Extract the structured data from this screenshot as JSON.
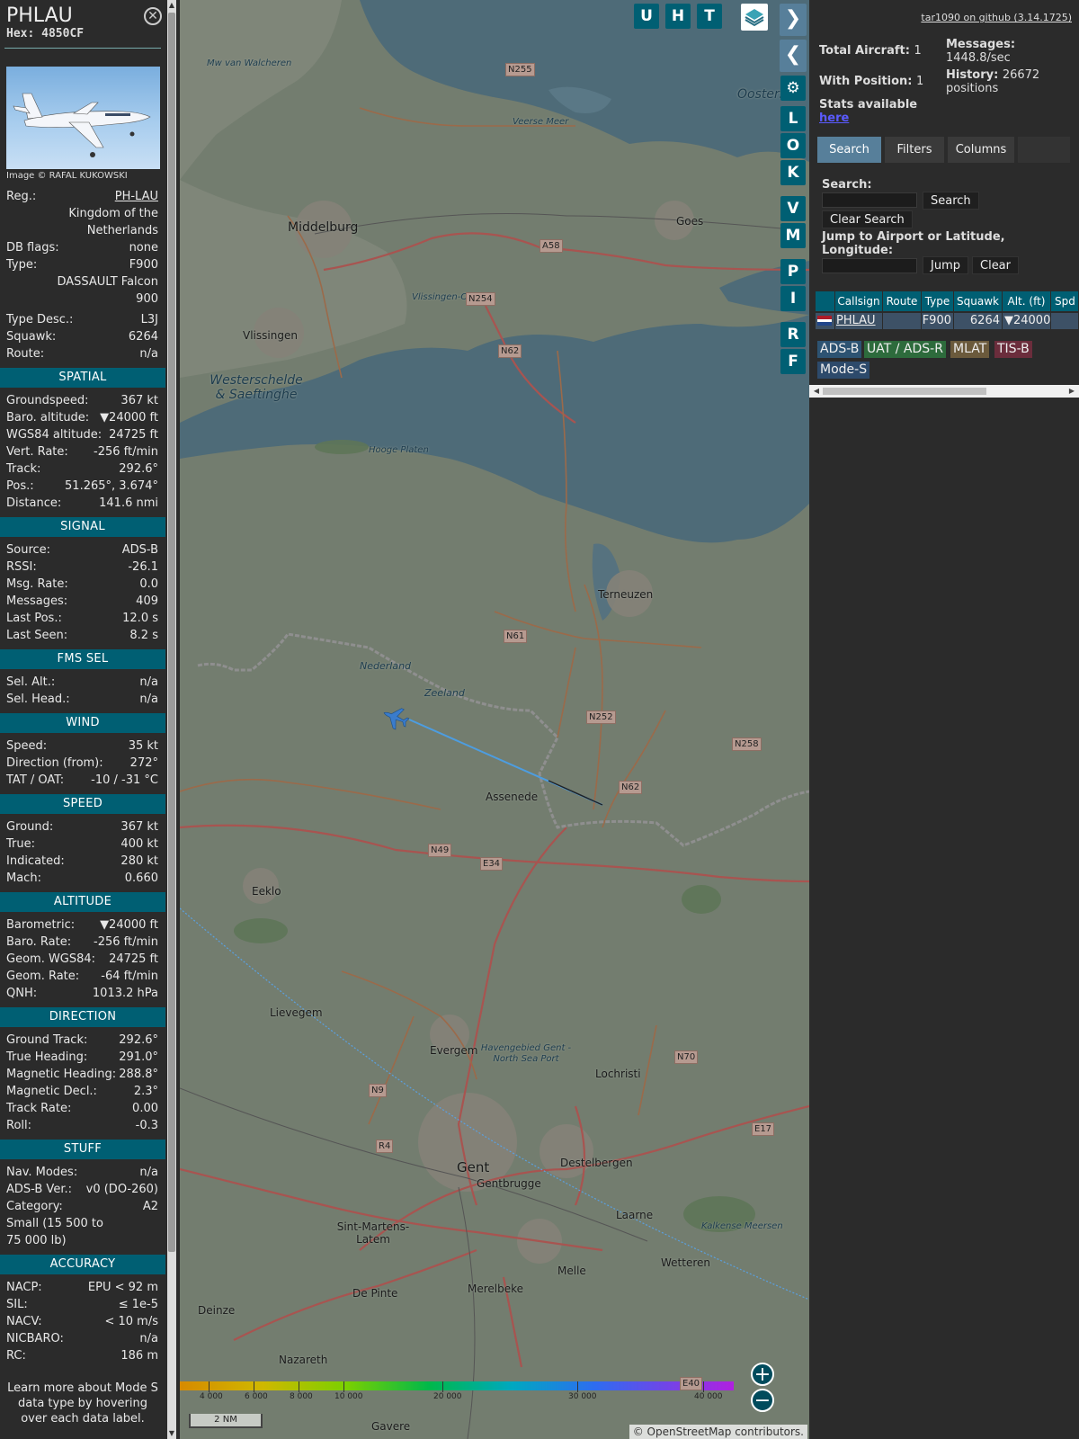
{
  "aircraft": {
    "callsign": "PHLAU",
    "hex": "Hex: 4850CF",
    "photo_caption": "Image © RAFAL KUKOWSKI",
    "details": [
      {
        "label": "Reg.:",
        "value": "PH-LAU"
      },
      {
        "label": "",
        "value": "Kingdom of the Netherlands"
      },
      {
        "label": "DB flags:",
        "value": "none"
      },
      {
        "label": "Type:",
        "value": "F900"
      },
      {
        "label": "",
        "value": "DASSAULT Falcon 900"
      },
      {
        "label": "Type Desc.:",
        "value": "L3J"
      },
      {
        "label": "Squawk:",
        "value": "6264"
      },
      {
        "label": "Route:",
        "value": "n/a"
      }
    ]
  },
  "sections": [
    {
      "title": "SPATIAL",
      "rows": [
        {
          "label": "Groundspeed:",
          "value": "367 kt"
        },
        {
          "label": "Baro. altitude:",
          "value": "▼24000 ft"
        },
        {
          "label": "WGS84 altitude:",
          "value": "24725 ft"
        },
        {
          "label": "Vert. Rate:",
          "value": "-256 ft/min"
        },
        {
          "label": "Track:",
          "value": "292.6°"
        },
        {
          "label": "Pos.:",
          "value": "51.265°, 3.674°"
        },
        {
          "label": "Distance:",
          "value": "141.6 nmi"
        }
      ]
    },
    {
      "title": "SIGNAL",
      "rows": [
        {
          "label": "Source:",
          "value": "ADS-B"
        },
        {
          "label": "RSSI:",
          "value": "-26.1"
        },
        {
          "label": "Msg. Rate:",
          "value": "0.0"
        },
        {
          "label": "Messages:",
          "value": "409"
        },
        {
          "label": "Last Pos.:",
          "value": "12.0 s"
        },
        {
          "label": "Last Seen:",
          "value": "8.2 s"
        }
      ]
    },
    {
      "title": "FMS SEL",
      "rows": [
        {
          "label": "Sel. Alt.:",
          "value": "n/a"
        },
        {
          "label": "Sel. Head.:",
          "value": "n/a"
        }
      ]
    },
    {
      "title": "WIND",
      "rows": [
        {
          "label": "Speed:",
          "value": "35 kt"
        },
        {
          "label": "Direction (from):",
          "value": "272°"
        },
        {
          "label": "TAT / OAT:",
          "value": "-10 / -31 °C"
        }
      ]
    },
    {
      "title": "SPEED",
      "rows": [
        {
          "label": "Ground:",
          "value": "367 kt"
        },
        {
          "label": "True:",
          "value": "400 kt"
        },
        {
          "label": "Indicated:",
          "value": "280 kt"
        },
        {
          "label": "Mach:",
          "value": "0.660"
        }
      ]
    },
    {
      "title": "ALTITUDE",
      "rows": [
        {
          "label": "Barometric:",
          "value": "▼24000 ft"
        },
        {
          "label": "Baro. Rate:",
          "value": "-256 ft/min"
        },
        {
          "label": "Geom. WGS84:",
          "value": "24725 ft"
        },
        {
          "label": "Geom. Rate:",
          "value": "-64 ft/min"
        },
        {
          "label": "QNH:",
          "value": "1013.2 hPa"
        }
      ]
    },
    {
      "title": "DIRECTION",
      "rows": [
        {
          "label": "Ground Track:",
          "value": "292.6°"
        },
        {
          "label": "True Heading:",
          "value": "291.0°"
        },
        {
          "label": "Magnetic Heading:",
          "value": "288.8°"
        },
        {
          "label": "Magnetic Decl.:",
          "value": "2.3°"
        },
        {
          "label": "Track Rate:",
          "value": "0.00"
        },
        {
          "label": "Roll:",
          "value": "-0.3"
        }
      ]
    },
    {
      "title": "STUFF",
      "rows": [
        {
          "label": "Nav. Modes:",
          "value": "n/a"
        },
        {
          "label": "ADS-B Ver.:",
          "value": "v0 (DO-260)"
        },
        {
          "label": "Category:",
          "value": "A2"
        },
        {
          "label": "Small (15 500 to 75 000 lb)",
          "value": ""
        }
      ]
    },
    {
      "title": "ACCURACY",
      "rows": [
        {
          "label": "NACP:",
          "value": "EPU < 92 m"
        },
        {
          "label": "SIL:",
          "value": "≤ 1e-5"
        },
        {
          "label": "NACV:",
          "value": "< 10 m/s"
        },
        {
          "label": "NICBARO:",
          "value": "n/a"
        },
        {
          "label": "RC:",
          "value": "186 m"
        }
      ]
    }
  ],
  "footer_note": "Learn more about Mode S data type by hovering over each data label.",
  "map": {
    "buttons": [
      "U",
      "H",
      "T",
      "L",
      "O",
      "K",
      "V",
      "M",
      "P",
      "I",
      "R",
      "F"
    ],
    "labels": [
      {
        "id": "middelburg",
        "text": "Middelburg"
      },
      {
        "id": "vlissingen",
        "text": "Vlissingen"
      },
      {
        "id": "goes",
        "text": "Goes"
      },
      {
        "id": "terneuzen",
        "text": "Terneuzen"
      },
      {
        "id": "assenede",
        "text": "Assenede"
      },
      {
        "id": "eeklo",
        "text": "Eeklo"
      },
      {
        "id": "lievegem",
        "text": "Lievegem"
      },
      {
        "id": "evergem",
        "text": "Evergem"
      },
      {
        "id": "lochristi",
        "text": "Lochristi"
      },
      {
        "id": "gent",
        "text": "Gent"
      },
      {
        "id": "destelbergen",
        "text": "Destelbergen"
      },
      {
        "id": "gentbrugge",
        "text": "Gentbrugge"
      },
      {
        "id": "sintmartens",
        "text": "Sint-Martens-Latem"
      },
      {
        "id": "laarne",
        "text": "Laarne"
      },
      {
        "id": "wetteren",
        "text": "Wetteren"
      },
      {
        "id": "melle",
        "text": "Melle"
      },
      {
        "id": "merelbeke",
        "text": "Merelbeke"
      },
      {
        "id": "depinte",
        "text": "De Pinte"
      },
      {
        "id": "deinze",
        "text": "Deinze"
      },
      {
        "id": "nazareth",
        "text": "Nazareth"
      },
      {
        "id": "gavere",
        "text": "Gavere"
      },
      {
        "id": "westerschelde",
        "text": "Westerschelde & Saeftinghe"
      },
      {
        "id": "nederland",
        "text": "Nederland"
      },
      {
        "id": "zeeland",
        "text": "Zeeland"
      },
      {
        "id": "oosters",
        "text": "Oosters"
      },
      {
        "id": "veersemeer",
        "text": "Veerse Meer"
      },
      {
        "id": "havengebied",
        "text": "Havengebied Gent - North Sea Port"
      },
      {
        "id": "kalkense",
        "text": "Kalkense Meersen"
      },
      {
        "id": "vlissingenoost",
        "text": "Vlissingen-Oost"
      },
      {
        "id": "hoogeplaten",
        "text": "Hooge Platen"
      },
      {
        "id": "mw",
        "text": "Mw van Walcheren"
      }
    ],
    "road_shields": [
      "N255",
      "A58",
      "N254",
      "N62",
      "N61",
      "N252",
      "N258",
      "N62",
      "E34",
      "N49",
      "N70",
      "N9",
      "R4",
      "E17",
      "E40"
    ],
    "altitude_scale": [
      "4 000",
      "6 000",
      "8 000",
      "10 000",
      "20 000",
      "30 000",
      "40 000"
    ],
    "scale_bar": "2 NM",
    "attribution": "© OpenStreetMap contributors."
  },
  "side": {
    "github": "tar1090 on github (3.14.1725)",
    "total_aircraft_label": "Total Aircraft:",
    "total_aircraft": "1",
    "with_position_label": "With Position:",
    "with_position": "1",
    "stats_label": "Stats available",
    "stats_link": "here",
    "messages_label": "Messages:",
    "messages": "1448.8/sec",
    "history_label": "History:",
    "history": "26672 positions",
    "tabs": [
      "Search",
      "Filters",
      "Columns"
    ],
    "search_label": "Search:",
    "search_button": "Search",
    "clear_search": "Clear Search",
    "jump_label": "Jump to Airport or Latitude, Longitude:",
    "jump_button": "Jump",
    "clear_button": "Clear",
    "columns": [
      "",
      "Callsign",
      "Route",
      "Type",
      "Squawk",
      "Alt. (ft)",
      "Spd"
    ],
    "row": {
      "callsign": "PHLAU",
      "route": "",
      "type": "F900",
      "squawk": "6264",
      "alt": "▼24000"
    },
    "legend": [
      {
        "label": "ADS-B",
        "color": "#2d5372"
      },
      {
        "label": "UAT / ADS-R",
        "color": "#2d6b3c"
      },
      {
        "label": "MLAT",
        "color": "#6b5a3c"
      },
      {
        "label": "TIS-B",
        "color": "#6b2d3c"
      },
      {
        "label": "Mode-S",
        "color": "#2d4a6b"
      }
    ]
  }
}
